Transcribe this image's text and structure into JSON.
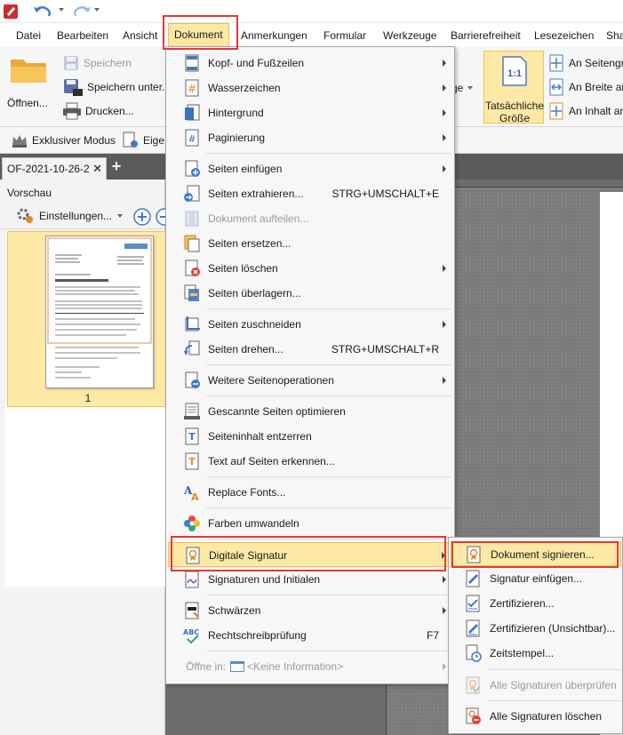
{
  "menubar": {
    "tabs": [
      "Datei",
      "Bearbeiten",
      "Ansicht",
      "Dokument",
      "Anmerkungen",
      "Formular",
      "Werkzeuge",
      "Barrierefreiheit",
      "Lesezeichen",
      "Sha"
    ]
  },
  "ribbon": {
    "open_label": "Öffnen...",
    "save_label": "Speichern",
    "save_as_label": "Speichern unter...",
    "print_label": "Drucken...",
    "ge_label": "ge",
    "actual_size_label_1": "Tatsächliche",
    "actual_size_label_2": "Größe",
    "actual_size_icon_text": "1:1",
    "fit_page_label": "An Seitengr",
    "fit_width_label": "An Breite an",
    "fit_content_label": "An Inhalt an"
  },
  "toolbar2": {
    "exclusive_mode_label": "Exklusiver Modus",
    "properties_label": "Eige"
  },
  "tabbar": {
    "doc_tab_label": "OF-2021-10-26-2",
    "close_glyph": "✕",
    "new_tab_glyph": "+"
  },
  "preview": {
    "title": "Vorschau",
    "settings_label": "Einstellungen...",
    "page_number": "1"
  },
  "dropdown": {
    "items": [
      {
        "label": "Kopf- und Fußzeilen",
        "shortcut": "",
        "submenu": true
      },
      {
        "label": "Wasserzeichen",
        "shortcut": "",
        "submenu": true
      },
      {
        "label": "Hintergrund",
        "shortcut": "",
        "submenu": true
      },
      {
        "label": "Paginierung",
        "shortcut": "",
        "submenu": true
      },
      {
        "label": "Seiten einfügen",
        "shortcut": "",
        "submenu": true
      },
      {
        "label": "Seiten extrahieren...",
        "shortcut": "STRG+UMSCHALT+E",
        "submenu": false
      },
      {
        "label": "Dokument aufteilen...",
        "shortcut": "",
        "submenu": false
      },
      {
        "label": "Seiten ersetzen...",
        "shortcut": "",
        "submenu": false
      },
      {
        "label": "Seiten löschen",
        "shortcut": "",
        "submenu": true
      },
      {
        "label": "Seiten überlagern...",
        "shortcut": "",
        "submenu": false
      },
      {
        "label": "Seiten zuschneiden",
        "shortcut": "",
        "submenu": true
      },
      {
        "label": "Seiten drehen...",
        "shortcut": "STRG+UMSCHALT+R",
        "submenu": false
      },
      {
        "label": "Weitere Seitenoperationen",
        "shortcut": "",
        "submenu": true
      },
      {
        "label": "Gescannte Seiten optimieren",
        "shortcut": "",
        "submenu": false
      },
      {
        "label": "Seiteninhalt entzerren",
        "shortcut": "",
        "submenu": false
      },
      {
        "label": "Text auf Seiten erkennen...",
        "shortcut": "",
        "submenu": false
      },
      {
        "label": "Replace Fonts...",
        "shortcut": "",
        "submenu": false
      },
      {
        "label": "Farben umwandeln",
        "shortcut": "",
        "submenu": false
      },
      {
        "label": "Digitale Signatur",
        "shortcut": "",
        "submenu": true
      },
      {
        "label": "Signaturen und Initialen",
        "shortcut": "",
        "submenu": true
      },
      {
        "label": "Schwärzen",
        "shortcut": "",
        "submenu": true
      },
      {
        "label": "Rechtschreibprüfung",
        "shortcut": "F7",
        "submenu": false
      },
      {
        "label": "Öffne in: ",
        "shortcut": "",
        "submenu": true
      },
      {
        "label": "<Keine Information>",
        "shortcut": "",
        "submenu": false
      }
    ]
  },
  "submenu": {
    "items": [
      {
        "label": "Dokument signieren..."
      },
      {
        "label": "Signatur einfügen..."
      },
      {
        "label": "Zertifizieren..."
      },
      {
        "label": "Zertifizieren (Unsichtbar)..."
      },
      {
        "label": "Zeitstempel..."
      },
      {
        "label": "Alle Signaturen überprüfen"
      },
      {
        "label": "Alle Signaturen löschen"
      }
    ]
  },
  "colors": {
    "highlight_fill": "#fde9a5",
    "highlight_border": "#e8c35a",
    "callout_red": "#e03a3a",
    "disabled_text": "#9a9a9a"
  }
}
